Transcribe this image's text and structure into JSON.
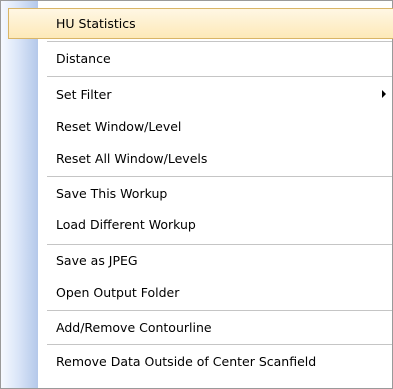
{
  "menu": {
    "items": [
      {
        "label": "HU Statistics"
      },
      {
        "label": "Distance"
      },
      {
        "label": "Set Filter"
      },
      {
        "label": "Reset Window/Level"
      },
      {
        "label": "Reset All Window/Levels"
      },
      {
        "label": "Save This Workup"
      },
      {
        "label": "Load Different Workup"
      },
      {
        "label": "Save as JPEG"
      },
      {
        "label": "Open Output Folder"
      },
      {
        "label": "Add/Remove Contourline"
      },
      {
        "label": "Remove Data Outside of Center Scanfield"
      }
    ],
    "highlighted_item": "HU Statistics",
    "submenu_indicator": "submenu-arrow-icon"
  },
  "colors": {
    "highlight_fill": "#fde9b8",
    "highlight_border": "#d9b567",
    "gutter": "#b4c8ea",
    "separator": "#c5c5c5"
  }
}
